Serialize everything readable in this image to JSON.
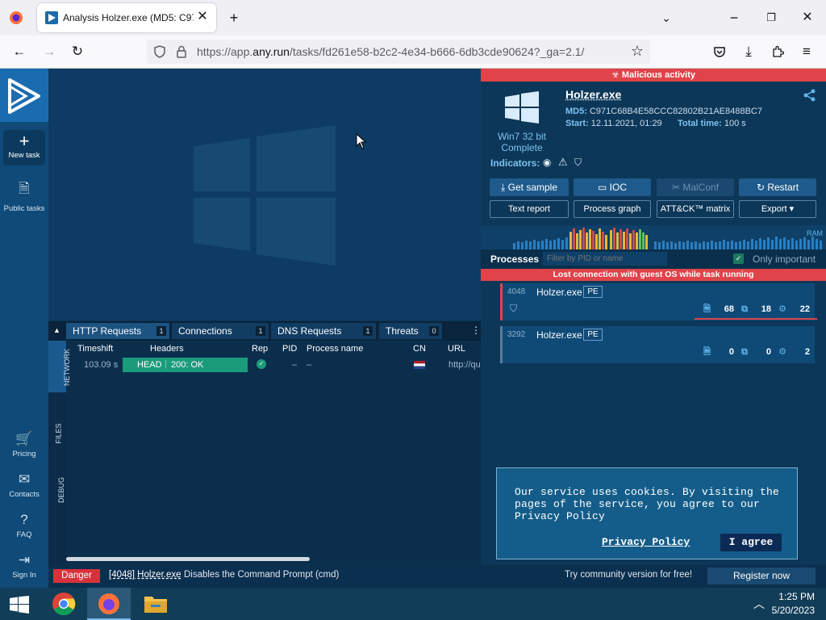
{
  "browser": {
    "tab_title": "Analysis Holzer.exe (MD5: C971",
    "url_prefix": "https://app.",
    "url_domain": "any.run",
    "url_suffix": "/tasks/fd261e58-b2c2-4e34-b666-6db3cde90624?_ga=2.1/"
  },
  "sidebar": {
    "new_task": "New task",
    "public_tasks": "Public tasks",
    "pricing": "Pricing",
    "contacts": "Contacts",
    "faq": "FAQ",
    "sign_in": "Sign In"
  },
  "network": {
    "tabs": [
      {
        "label": "HTTP Requests",
        "count": "1"
      },
      {
        "label": "Connections",
        "count": "1"
      },
      {
        "label": "DNS Requests",
        "count": "1"
      },
      {
        "label": "Threats",
        "count": "0"
      }
    ],
    "side_tabs": [
      "NETWORK",
      "FILES",
      "DEBUG"
    ],
    "columns": [
      "Timeshift",
      "Headers",
      "Rep",
      "PID",
      "Process name",
      "CN",
      "URL"
    ],
    "row": {
      "timeshift": "103.09 s",
      "method": "HEAD",
      "status": "200: OK",
      "pid": "–",
      "process": "–",
      "url": "http://qu"
    }
  },
  "analysis": {
    "banner": "Malicious activity",
    "os": "Win7 32 bit",
    "os_status": "Complete",
    "name": "Holzer.exe",
    "md5_label": "MD5:",
    "md5": "C971C68B4E58CCC82802B21AE8488BC7",
    "start_label": "Start:",
    "start": "12.11.2021, 01:29",
    "total_label": "Total time:",
    "total": "100 s",
    "indicators_label": "Indicators:",
    "buttons": [
      "Get sample",
      "IOC",
      "MalConf",
      "Restart"
    ],
    "outline_buttons": [
      "Text report",
      "Process graph",
      "ATT&CK™ matrix",
      "Export"
    ],
    "ram_label": "RAM",
    "processes_label": "Processes",
    "filter_placeholder": "Filter by PID or name",
    "only_important": "Only important",
    "lost_connection": "Lost connection with guest OS while task running"
  },
  "processes": [
    {
      "pid": "4048",
      "name": "Holzer.exe",
      "tag": "PE",
      "files": "68",
      "modules": "18",
      "registry": "22"
    },
    {
      "pid": "3292",
      "name": "Holzer.exe",
      "tag": "PE",
      "files": "0",
      "modules": "0",
      "registry": "2"
    }
  ],
  "cookie": {
    "text": "Our service uses cookies. By visiting the pages of the service, you agree to our Privacy Policy",
    "link": "Privacy Policy",
    "agree": "I agree"
  },
  "status": {
    "level": "Danger",
    "process": "[4048] Holzer.exe",
    "message": "Disables the Command Prompt (cmd)",
    "community": "Try community version for free!",
    "register": "Register now"
  },
  "taskbar": {
    "time": "1:25 PM",
    "date": "5/20/2023"
  },
  "colors": {
    "accent": "#1f5a8c",
    "danger": "#e0434a",
    "ok": "#1a9b7a"
  }
}
